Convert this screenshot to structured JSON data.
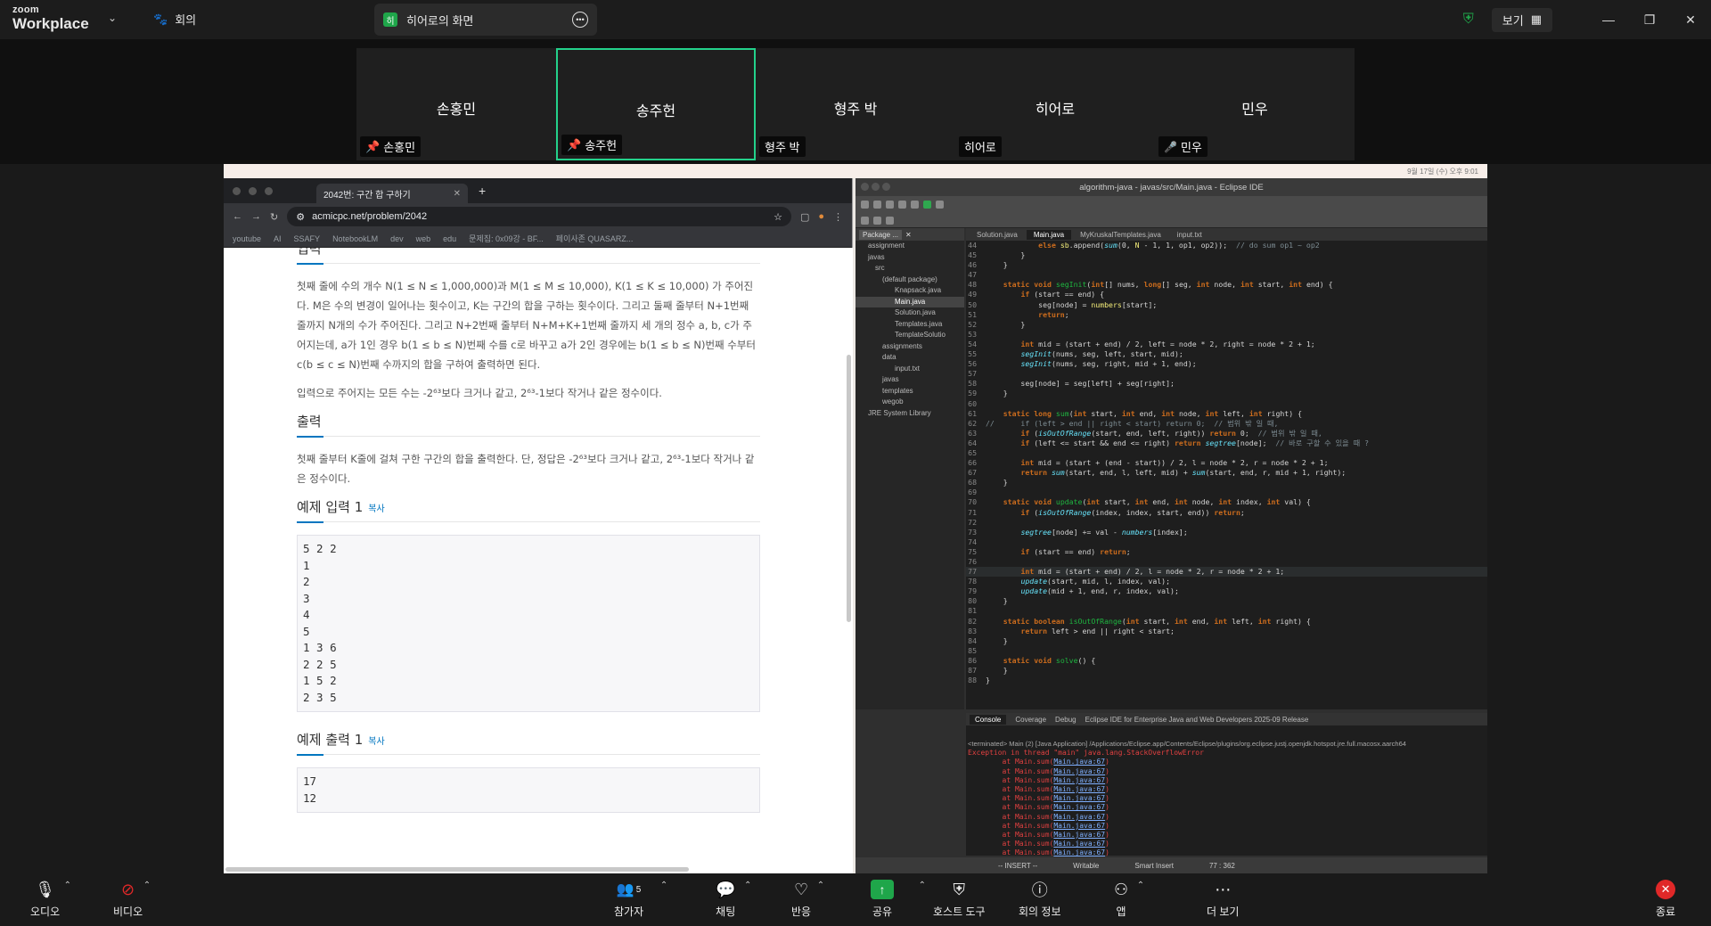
{
  "zoom": {
    "logo_top": "zoom",
    "logo_bottom": "Workplace",
    "meeting_label": "회의",
    "share_tab_badge": "히",
    "share_tab_title": "히어로의 화면",
    "view_label": "보기"
  },
  "gallery": [
    {
      "name": "손홍민",
      "tag": "손홍민"
    },
    {
      "name": "송주헌",
      "tag": "송주헌"
    },
    {
      "name": "형주 박",
      "tag": "형주 박"
    },
    {
      "name": "히어로",
      "tag": "히어로"
    },
    {
      "name": "민우",
      "tag": "민우"
    }
  ],
  "browser": {
    "tab_title": "2042번: 구간 합 구하기",
    "url": "acmicpc.net/problem/2042",
    "bookmarks": [
      "youtube",
      "AI",
      "SSAFY",
      "NotebookLM",
      "dev",
      "web",
      "edu",
      "문제집: 0x09강 - BF...",
      "페이사존 QUASARZ..."
    ],
    "section_input_partial": "입력",
    "input_text_1": "첫째 줄에 수의 개수 N(1 ≤ N ≤ 1,000,000)과 M(1 ≤ M ≤ 10,000), K(1 ≤ K ≤ 10,000) 가 주어진다. M은 수의 변경이 일어나는 횟수이고, K는 구간의 합을 구하는 횟수이다. 그리고 둘째 줄부터 N+1번째 줄까지 N개의 수가 주어진다. 그리고 N+2번째 줄부터 N+M+K+1번째 줄까지 세 개의 정수 a, b, c가 주어지는데, a가 1인 경우 b(1 ≤ b ≤ N)번째 수를 c로 바꾸고 a가 2인 경우에는 b(1 ≤ b ≤ N)번째 수부터 c(b ≤ c ≤ N)번째 수까지의 합을 구하여 출력하면 된다.",
    "input_text_2": "입력으로 주어지는 모든 수는 -2⁶³보다 크거나 같고, 2⁶³-1보다 작거나 같은 정수이다.",
    "section_output": "출력",
    "output_text": "첫째 줄부터 K줄에 걸쳐 구한 구간의 합을 출력한다. 단, 정답은 -2⁶³보다 크거나 같고, 2⁶³-1보다 작거나 같은 정수이다.",
    "sample_input_title": "예제 입력 1",
    "sample_output_title": "예제 출력 1",
    "copy_label": "복사",
    "sample_input": "5 2 2\n1\n2\n3\n4\n5\n1 3 6\n2 2 5\n1 5 2\n2 3 5",
    "sample_output": "17\n12"
  },
  "mac_status": "9월 17일 (수) 오후 9:01",
  "eclipse": {
    "title": "algorithm-java - javas/src/Main.java - Eclipse IDE",
    "pkg_tab": "Package ...",
    "tree": [
      "assignment",
      "javas",
      "src",
      "(default package)",
      "Knapsack.java",
      "Main.java",
      "Solution.java",
      "Templates.java",
      "TemplateSolutio",
      "assignments",
      "data",
      "input.txt",
      "javas",
      "templates",
      "wegob",
      "JRE System Library"
    ],
    "editor_tabs": [
      "Solution.java",
      "Main.java",
      "MyKruskalTemplates.java",
      "input.txt"
    ],
    "console_tabs": [
      "Console",
      "Coverage",
      "Debug",
      "Eclipse IDE for Enterprise Java and Web Developers 2025-09 Release"
    ],
    "terminated": "<terminated> Main (2) [Java Application] /Applications/Eclipse.app/Contents/Eclipse/plugins/org.eclipse.justj.openjdk.hotspot.jre.full.macosx.aarch64",
    "exception": "Exception in thread \"main\" java.lang.StackOverflowError",
    "trace_prefix": "        at Main.sum(",
    "trace_link": "Main.java:67",
    "status_mode": "-- INSERT --",
    "status_writable": "Writable",
    "status_insert": "Smart Insert",
    "status_pos": "77 : 362"
  },
  "controls": {
    "audio": "오디오",
    "video": "비디오",
    "participants": "참가자",
    "participants_count": "5",
    "chat": "채팅",
    "react": "반응",
    "share": "공유",
    "host_tools": "호스트 도구",
    "meeting_info": "회의 정보",
    "apps": "앱",
    "more": "더 보기",
    "end": "종료"
  }
}
